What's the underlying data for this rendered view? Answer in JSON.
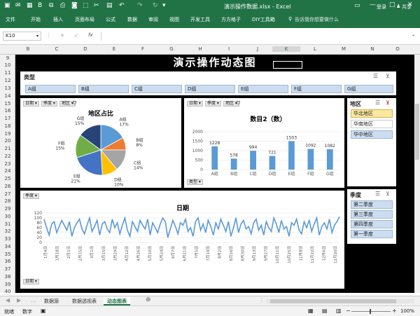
{
  "window": {
    "title": "演示操作数据.xlsx - Excel",
    "login": "登录"
  },
  "ribbon": {
    "tabs": [
      "文件",
      "开始",
      "插入",
      "页面布局",
      "公式",
      "数据",
      "审阅",
      "视图",
      "开发工具",
      "方方格子",
      "DIY工具箱"
    ],
    "tell_me": "告诉我你想要做什么",
    "share": "共享"
  },
  "formula": {
    "name_box": "K10",
    "cancel": "✕",
    "enter": "✓",
    "fx": "fx",
    "value": ""
  },
  "columns": [
    "B",
    "C",
    "D",
    "E",
    "F",
    "G",
    "H",
    "I",
    "J",
    "K",
    "L",
    "M",
    "N",
    "O"
  ],
  "rows": [
    "9",
    "10",
    "11",
    "12",
    "13",
    "14",
    "15",
    "16",
    "17",
    "18",
    "19",
    "20",
    "21",
    "22",
    "23",
    "24",
    "25",
    "26",
    "27",
    "28",
    "29",
    "30",
    "31",
    "32",
    "33",
    "34",
    "35",
    "36",
    "37",
    "38",
    "39",
    "40"
  ],
  "dashboard": {
    "title": "演示操作动态图"
  },
  "slicer_type": {
    "header": "类型",
    "items": [
      "A组",
      "B组",
      "C组",
      "D组",
      "E组",
      "F组",
      "G组"
    ]
  },
  "slicer_region": {
    "header": "地区",
    "items": [
      "华北地区",
      "华南地区",
      "华中地区"
    ]
  },
  "slicer_quarter": {
    "header": "季度",
    "items": [
      "第二季度",
      "第三季度",
      "第四季度",
      "第一季度"
    ]
  },
  "field_buttons": {
    "pie": [
      "日期 ▾",
      "季度 ▾",
      "地区 ▾"
    ],
    "bar": [
      "日期 ▾",
      "季度 ▾",
      "地区 ▾"
    ],
    "bar_bottom": "类型 ▾",
    "line_top": "季度 ▾",
    "line_bottom": "日期 ▾"
  },
  "chart_data": [
    {
      "type": "pie",
      "title": "地区占比",
      "categories": [
        "A组",
        "B组",
        "C组",
        "D组",
        "E组",
        "F组",
        "G组"
      ],
      "values": [
        17,
        8,
        14,
        10,
        21,
        15,
        15
      ],
      "value_labels": [
        "17%",
        "8%",
        "14%",
        "10%",
        "21%",
        "15%",
        "15%"
      ],
      "colors": [
        "#5b9bd5",
        "#ed7d31",
        "#a5a5a5",
        "#ffc000",
        "#4472c4",
        "#70ad47",
        "#264478"
      ]
    },
    {
      "type": "bar",
      "title": "数目2（数）",
      "categories": [
        "A组",
        "B组",
        "C组",
        "D组",
        "E组",
        "F组",
        "G组"
      ],
      "values": [
        1228,
        578,
        994,
        721,
        1503,
        1092,
        1082
      ],
      "ylim": [
        0,
        2000
      ],
      "yticks": [
        "0",
        "500",
        "1000",
        "1500",
        "2000"
      ],
      "color": "#5b9bd5"
    },
    {
      "type": "line",
      "title": "日期",
      "yticks": [
        "0",
        "20",
        "40",
        "60",
        "80",
        "100",
        "120"
      ],
      "ylim": [
        0,
        120
      ],
      "xticks": [
        "1月4日",
        "1月18日",
        "2月1日",
        "2月15日",
        "3月1日",
        "3月15日",
        "3月29日",
        "4月12日",
        "4月26日",
        "5月10日",
        "5月24日",
        "6月7日",
        "6月21日",
        "7月5日",
        "7月19日",
        "8月2日",
        "8月16日",
        "8月30日",
        "9月13日",
        "9月27日",
        "10月11日",
        "10月25日",
        "11月8日",
        "11月22日",
        "12月6日",
        "12月20日"
      ],
      "values": [
        95,
        60,
        30,
        75,
        85,
        40,
        65,
        90,
        70,
        50,
        85,
        25,
        60,
        80,
        95,
        55,
        35,
        70,
        100,
        45,
        65,
        90,
        30,
        75,
        85,
        55,
        40,
        95,
        60,
        80,
        35,
        70,
        100,
        50,
        25,
        85,
        65,
        45,
        90,
        70,
        55,
        95,
        30,
        80,
        60,
        40,
        75,
        100,
        85,
        20,
        55,
        90,
        65,
        35,
        80,
        70,
        95,
        45,
        60,
        25,
        85,
        100,
        50,
        75,
        40,
        90,
        65,
        30,
        80,
        55,
        95,
        70,
        45,
        85,
        25,
        60,
        100,
        40,
        75,
        90,
        55,
        65,
        35,
        80,
        95,
        50,
        70,
        30,
        85,
        60,
        45,
        100,
        75,
        40,
        90,
        55,
        65,
        25,
        80,
        70,
        95,
        50,
        35,
        85,
        60,
        90,
        45,
        75,
        100,
        30,
        65,
        80,
        55,
        95,
        40,
        70,
        85,
        105
      ]
    }
  ],
  "sheet_tabs": [
    "数据源",
    "数据透视表",
    "动态图表"
  ],
  "active_sheet": "动态图表",
  "status": {
    "left1": "就绪",
    "left2": "数字",
    "zoom": "100%"
  }
}
